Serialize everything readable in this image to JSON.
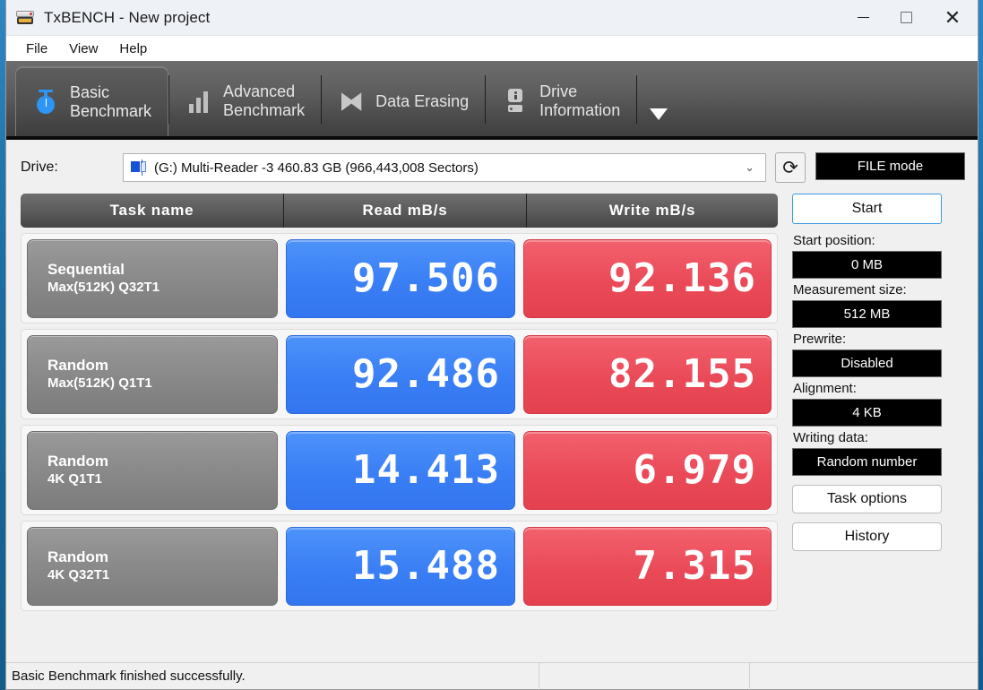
{
  "window": {
    "title": "TxBENCH - New project",
    "app_icon": "hdd-icon",
    "controls": {
      "minimize": "minimize-icon",
      "maximize": "maximize-icon",
      "close": "close-icon"
    }
  },
  "menubar": {
    "items": [
      "File",
      "View",
      "Help"
    ]
  },
  "tabs": [
    {
      "id": "basic-benchmark",
      "line1": "Basic",
      "line2": "Benchmark",
      "icon": "stopwatch-icon",
      "active": true
    },
    {
      "id": "advanced-benchmark",
      "line1": "Advanced",
      "line2": "Benchmark",
      "icon": "bar-chart-icon",
      "active": false
    },
    {
      "id": "data-erasing",
      "line1": "Data Erasing",
      "line2": "",
      "icon": "erase-icon",
      "active": false
    },
    {
      "id": "drive-information",
      "line1": "Drive",
      "line2": "Information",
      "icon": "drive-info-icon",
      "active": false
    }
  ],
  "tab_overflow": "chevron-down-icon",
  "drive": {
    "label": "Drive:",
    "selected": "(G:) Multi-Reader  -3  460.83 GB (966,443,008 Sectors)",
    "refresh_icon": "refresh-icon",
    "mode_button": "FILE mode"
  },
  "results": {
    "columns": [
      "Task name",
      "Read mB/s",
      "Write mB/s"
    ],
    "rows": [
      {
        "task_line1": "Sequential",
        "task_line2": "Max(512K) Q32T1",
        "read": "97.506",
        "write": "92.136"
      },
      {
        "task_line1": "Random",
        "task_line2": "Max(512K) Q1T1",
        "read": "92.486",
        "write": "82.155"
      },
      {
        "task_line1": "Random",
        "task_line2": "4K Q1T1",
        "read": "14.413",
        "write": "6.979"
      },
      {
        "task_line1": "Random",
        "task_line2": "4K Q32T1",
        "read": "15.488",
        "write": "7.315"
      }
    ]
  },
  "side_panel": {
    "start_button": "Start",
    "fields": [
      {
        "label": "Start position:",
        "value": "0 MB"
      },
      {
        "label": "Measurement size:",
        "value": "512 MB"
      },
      {
        "label": "Prewrite:",
        "value": "Disabled"
      },
      {
        "label": "Alignment:",
        "value": "4 KB"
      },
      {
        "label": "Writing data:",
        "value": "Random number"
      }
    ],
    "task_options_button": "Task options",
    "history_button": "History"
  },
  "statusbar": {
    "message": "Basic Benchmark finished successfully."
  },
  "colors": {
    "read_bar": "#3a7ef5",
    "write_bar": "#ea4a58",
    "task_bar": "#8b8b8b",
    "accent": "#2e95f5",
    "chrome_dark": "#4b4b4b"
  }
}
